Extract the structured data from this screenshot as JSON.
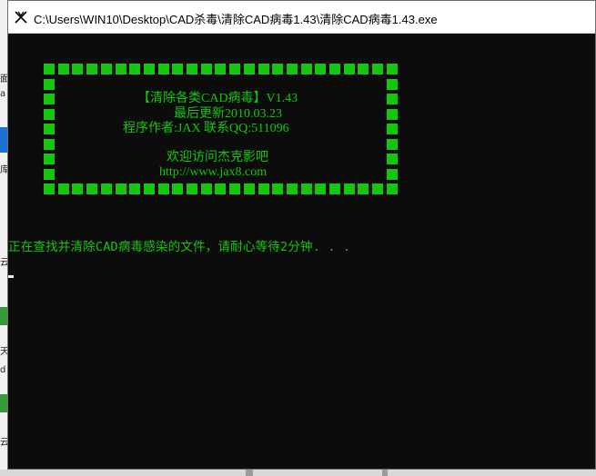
{
  "window": {
    "title": "C:\\Users\\WIN10\\Desktop\\CAD杀毒\\清除CAD病毒1.43\\清除CAD病毒1.43.exe",
    "icon": "console-app-icon"
  },
  "banner": {
    "line1": "【清除各类CAD病毒】V1.43",
    "line2": "最后更新2010.03.23",
    "line3": "程序作者:JAX   联系QQ:511096",
    "line4": "欢迎访问杰克影吧",
    "line5": "http://www.jax8.com"
  },
  "console": {
    "status": "正在查找并清除CAD病毒感染的文件，请耐心等待2分钟. . ."
  },
  "desktop_fragments": [
    "面",
    "a",
    "库",
    "云",
    "天",
    "d",
    "云"
  ],
  "colors": {
    "console_bg": "#0c0c0c",
    "console_green": "#16c60c",
    "cursor": "#f2f2f2"
  }
}
